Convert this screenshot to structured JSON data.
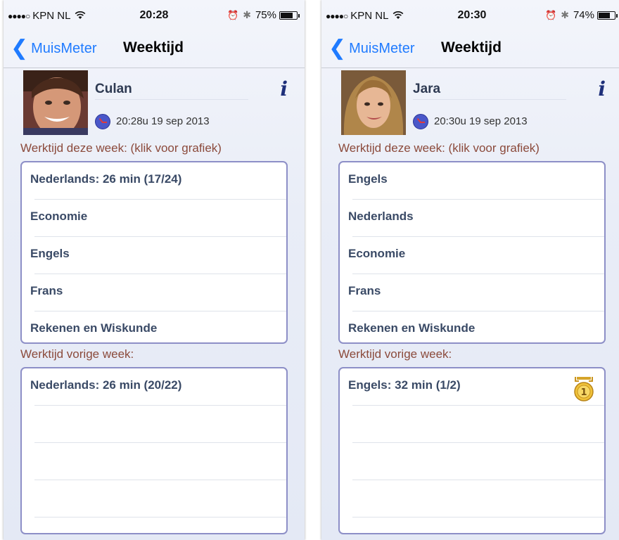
{
  "screens": [
    {
      "status": {
        "carrier": "KPN NL",
        "time": "20:28",
        "battery_pct": "75%",
        "battery_level": 0.75
      },
      "nav": {
        "back_label": "MuisMeter",
        "title": "Weektijd"
      },
      "profile": {
        "name": "Culan",
        "timestamp": "20:28u 19 sep 2013"
      },
      "this_week": {
        "label": "Werktijd deze week: (klik voor grafiek)",
        "rows": [
          "Nederlands: 26 min  (17/24)",
          "Economie",
          "Engels",
          "Frans",
          "Rekenen en Wiskunde"
        ]
      },
      "last_week": {
        "label": "Werktijd vorige week:",
        "rows": [
          "Nederlands: 26 min  (20/22)",
          "",
          "",
          "",
          ""
        ]
      }
    },
    {
      "status": {
        "carrier": "KPN NL",
        "time": "20:30",
        "battery_pct": "74%",
        "battery_level": 0.74
      },
      "nav": {
        "back_label": "MuisMeter",
        "title": "Weektijd"
      },
      "profile": {
        "name": "Jara",
        "timestamp": "20:30u 19 sep 2013"
      },
      "this_week": {
        "label": "Werktijd deze week: (klik voor grafiek)",
        "rows": [
          "Engels",
          "Nederlands",
          "Economie",
          "Frans",
          "Rekenen en Wiskunde"
        ]
      },
      "last_week": {
        "label": "Werktijd vorige week:",
        "rows": [
          "Engels: 32 min  (1/2)",
          "",
          "",
          "",
          ""
        ],
        "medal": "1"
      }
    }
  ],
  "icons": {
    "signal": "signal-dots-icon",
    "wifi": "wifi-icon",
    "alarm": "alarm-icon",
    "bluetooth": "bluetooth-icon",
    "battery": "battery-icon",
    "back": "chevron-left-icon",
    "info": "info-icon",
    "clock": "clock-icon",
    "medal": "gold-medal-icon"
  },
  "colors": {
    "accent": "#1f7bff",
    "section_label": "#8b4a3b",
    "card_border": "#8d8fc7",
    "row_text": "#3a4a66"
  }
}
